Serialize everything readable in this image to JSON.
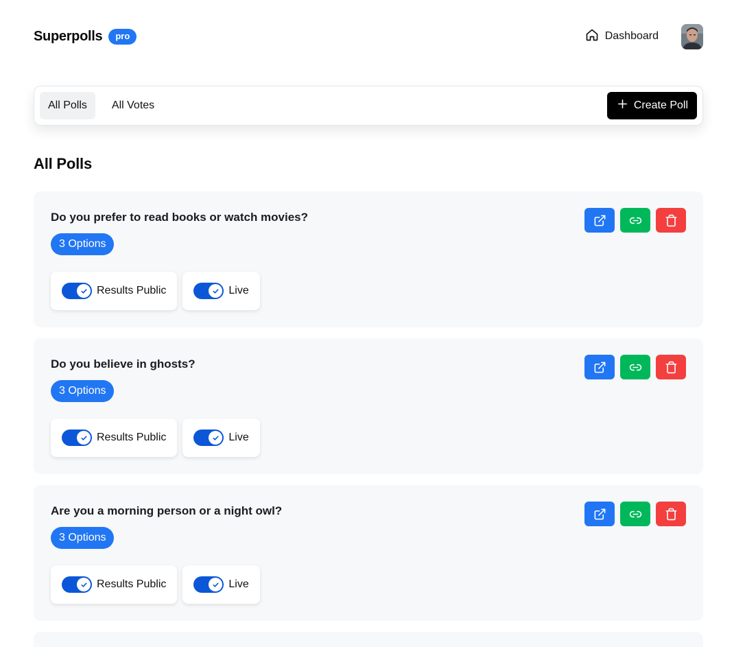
{
  "header": {
    "brand": "Superpolls",
    "badge": "pro",
    "dashboard_label": "Dashboard"
  },
  "tabs": [
    {
      "label": "All Polls",
      "active": true
    },
    {
      "label": "All Votes",
      "active": false
    }
  ],
  "create_label": "Create Poll",
  "section_title": "All Polls",
  "polls": [
    {
      "question": "Do you prefer to read books or watch movies?",
      "options_label": "3 Options",
      "results_public_label": "Results Public",
      "results_public": true,
      "live_label": "Live",
      "live": true
    },
    {
      "question": "Do you believe in ghosts?",
      "options_label": "3 Options",
      "results_public_label": "Results Public",
      "results_public": true,
      "live_label": "Live",
      "live": true
    },
    {
      "question": "Are you a morning person or a night owl?",
      "options_label": "3 Options",
      "results_public_label": "Results Public",
      "results_public": true,
      "live_label": "Live",
      "live": true
    }
  ],
  "colors": {
    "primary": "#2176f3",
    "toggle": "#0b57d8",
    "success": "#00b85a",
    "danger": "#f43f3f",
    "card_bg": "#f7f8fa"
  },
  "icons": {
    "dashboard": "home-icon",
    "create": "plus-icon",
    "open": "external-link-icon",
    "copy": "link-icon",
    "delete": "trash-icon",
    "toggle": "check-icon"
  }
}
